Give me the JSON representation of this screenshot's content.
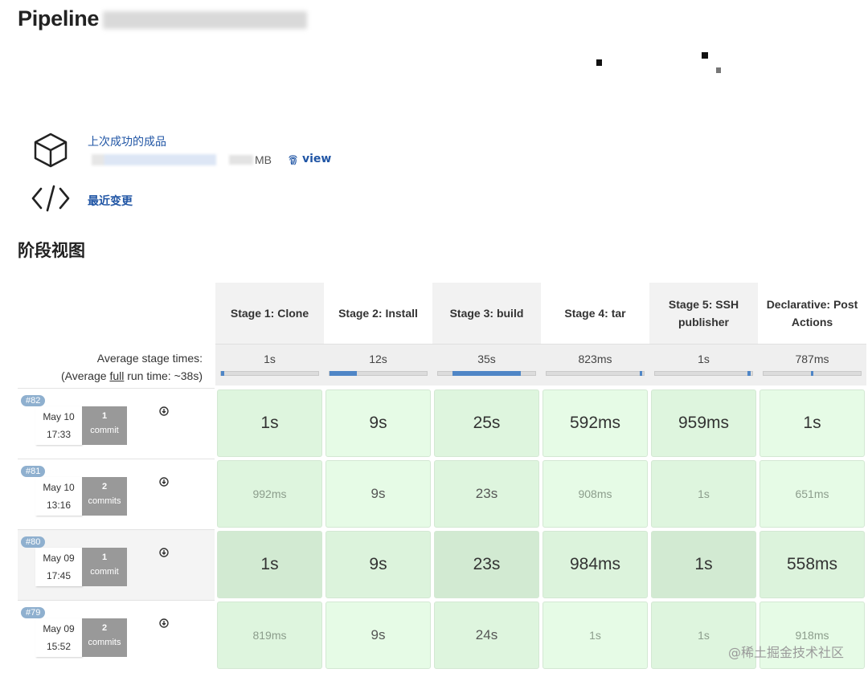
{
  "header": {
    "title": "Pipeline"
  },
  "artifacts": {
    "link_label": "上次成功的成品",
    "size_suffix": "MB",
    "view_label": "view",
    "changes_label": "最近变更"
  },
  "section_title": "阶段视图",
  "stages": [
    {
      "name": "Stage 1: Clone",
      "avg": "1s",
      "avg_fraction": 0.03
    },
    {
      "name": "Stage 2: Install",
      "avg": "12s",
      "avg_fraction": 0.28
    },
    {
      "name": "Stage 3: build",
      "avg": "35s",
      "avg_fraction": 0.7
    },
    {
      "name": "Stage 4: tar",
      "avg": "823ms",
      "avg_fraction": 0.02
    },
    {
      "name": "Stage 5: SSH publisher",
      "avg": "1s",
      "avg_fraction": 0.03
    },
    {
      "name": "Declarative: Post Actions",
      "avg": "787ms",
      "avg_fraction": 0.02
    }
  ],
  "average": {
    "label": "Average stage times:",
    "run_prefix": "(Average ",
    "run_link": "full",
    "run_suffix": " run time: ~38s)"
  },
  "runs": [
    {
      "build": "#82",
      "date": "May 10",
      "time": "17:33",
      "commit_count": "1",
      "commit_label": "commit",
      "times": [
        "1s",
        "9s",
        "25s",
        "592ms",
        "959ms",
        "1s"
      ]
    },
    {
      "build": "#81",
      "date": "May 10",
      "time": "13:16",
      "commit_count": "2",
      "commit_label": "commits",
      "times": [
        "992ms",
        "9s",
        "23s",
        "908ms",
        "1s",
        "651ms"
      ]
    },
    {
      "build": "#80",
      "date": "May 09",
      "time": "17:45",
      "commit_count": "1",
      "commit_label": "commit",
      "times": [
        "1s",
        "9s",
        "23s",
        "984ms",
        "1s",
        "558ms"
      ]
    },
    {
      "build": "#79",
      "date": "May 09",
      "time": "15:52",
      "commit_count": "2",
      "commit_label": "commits",
      "times": [
        "819ms",
        "9s",
        "24s",
        "1s",
        "1s",
        "918ms"
      ]
    }
  ],
  "watermark": "@稀土掘金技术社区",
  "colors": {
    "link": "#2156a5",
    "success_cell": "#e3f8e3",
    "success_cell_dark": "#d4ecd4",
    "badge": "#8fb0cf"
  }
}
